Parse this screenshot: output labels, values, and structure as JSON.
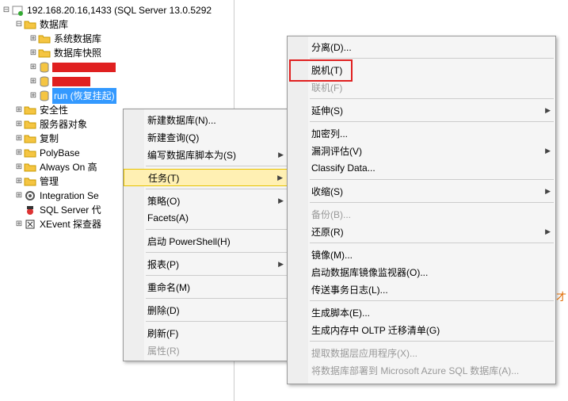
{
  "tree": {
    "server": "192.168.20.16,1433 (SQL Server 13.0.5292",
    "databases": "数据库",
    "sysdb": "系统数据库",
    "dbsnap": "数据库快照",
    "run_db": "run (恢复挂起)",
    "security": "安全性",
    "server_objects": "服务器对象",
    "replication": "复制",
    "polybase": "PolyBase",
    "alwayson": "Always On 高",
    "management": "管理",
    "integration": "Integration Se",
    "sqlagent": "SQL Server 代",
    "xevent": "XEvent 探查器"
  },
  "menu1": {
    "new_db": "新建数据库(N)...",
    "new_query": "新建查询(Q)",
    "script_db": "编写数据库脚本为(S)",
    "tasks": "任务(T)",
    "policies": "策略(O)",
    "facets": "Facets(A)",
    "powershell": "启动 PowerShell(H)",
    "reports": "报表(P)",
    "rename": "重命名(M)",
    "delete": "删除(D)",
    "refresh": "刷新(F)",
    "properties": "属性(R)"
  },
  "menu2": {
    "detach": "分离(D)...",
    "offline": "脱机(T)",
    "online": "联机(F)",
    "stretch": "延伸(S)",
    "encrypt": "加密列...",
    "vuln": "漏洞评估(V)",
    "classify": "Classify Data...",
    "shrink": "收缩(S)",
    "backup": "备份(B)...",
    "restore": "还原(R)",
    "mirror": "镜像(M)...",
    "launch_monitor": "启动数据库镜像监视器(O)...",
    "ship_log": "传送事务日志(L)...",
    "gen_script": "生成脚本(E)...",
    "oltp": "生成内存中 OLTP 迁移清单(G)",
    "extract": "提取数据层应用程序(X)...",
    "azure": "将数据库部署到 Microsoft Azure SQL 数据库(A)..."
  },
  "misc": {
    "orange": "才"
  }
}
